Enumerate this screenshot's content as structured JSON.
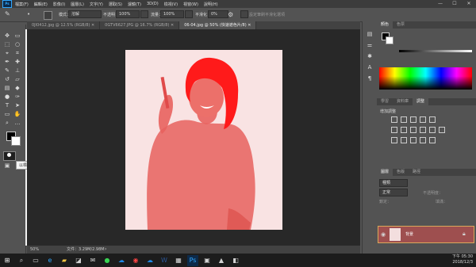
{
  "menu": {
    "app_logo": "Ps",
    "items": [
      "檔案(F)",
      "編輯(E)",
      "影像(I)",
      "圖層(L)",
      "文字(Y)",
      "選取(S)",
      "濾鏡(T)",
      "3D(D)",
      "檢視(V)",
      "視窗(W)",
      "說明(H)"
    ],
    "window_controls": [
      "—",
      "☐",
      "✕"
    ]
  },
  "options": {
    "mode_label": "模式：",
    "mode_value": "溶解",
    "opacity_label": "不透明：",
    "opacity_value": "100%",
    "flow_label": "流量：",
    "flow_value": "100%",
    "smooth_label": "平滑化：",
    "smooth_value": "0%",
    "tablet_label": "設定筆刷平滑化選項"
  },
  "tabs": [
    {
      "label": "0JI0412.jpg @ 12.5% (RGB/8) ✕",
      "active": false
    },
    {
      "label": "0GTV6627.JPG @ 16.7% (RGB/8) ✕",
      "active": false
    },
    {
      "label": "06-04.jpg @ 50% (快速遮色片/8) ✕",
      "active": true
    }
  ],
  "tooltip": {
    "text": "以標準模式編輯 (Q)"
  },
  "status": {
    "zoom": "50%",
    "doc_info": "文件：3.29M/2.98M"
  },
  "color_panel": {
    "tabs": [
      "顏色",
      "色票"
    ]
  },
  "adjust_panel": {
    "tabs": [
      "學習",
      "資料庫",
      "調整"
    ],
    "title": "增加調整"
  },
  "layers_panel": {
    "tabs": [
      "圖層",
      "色版",
      "路徑"
    ],
    "kind_label": "種類",
    "blend_mode": "正常",
    "opacity_label": "不透明度：",
    "lock_label": "鎖定：",
    "fill_label": "填滿：",
    "layer_name": "背景"
  },
  "taskbar": {
    "time": "下午 05:30",
    "date": "2018/12/3",
    "icons": [
      "windows-icon",
      "search-icon",
      "taskview-icon",
      "edge-icon",
      "file-explorer-icon",
      "store-icon",
      "mail-icon",
      "line-icon",
      "onedrive-icon",
      "chrome-icon",
      "onedrive2-icon",
      "word-icon",
      "teams-icon",
      "photoshop-icon",
      "explorer2-icon",
      "photos-icon",
      "app-icon"
    ]
  },
  "colors": {
    "quickmask": "#e8625e",
    "hair_mask": "#ff1a1a",
    "layer_highlight": "#9e4f4f",
    "accent": "#31a8ff"
  }
}
